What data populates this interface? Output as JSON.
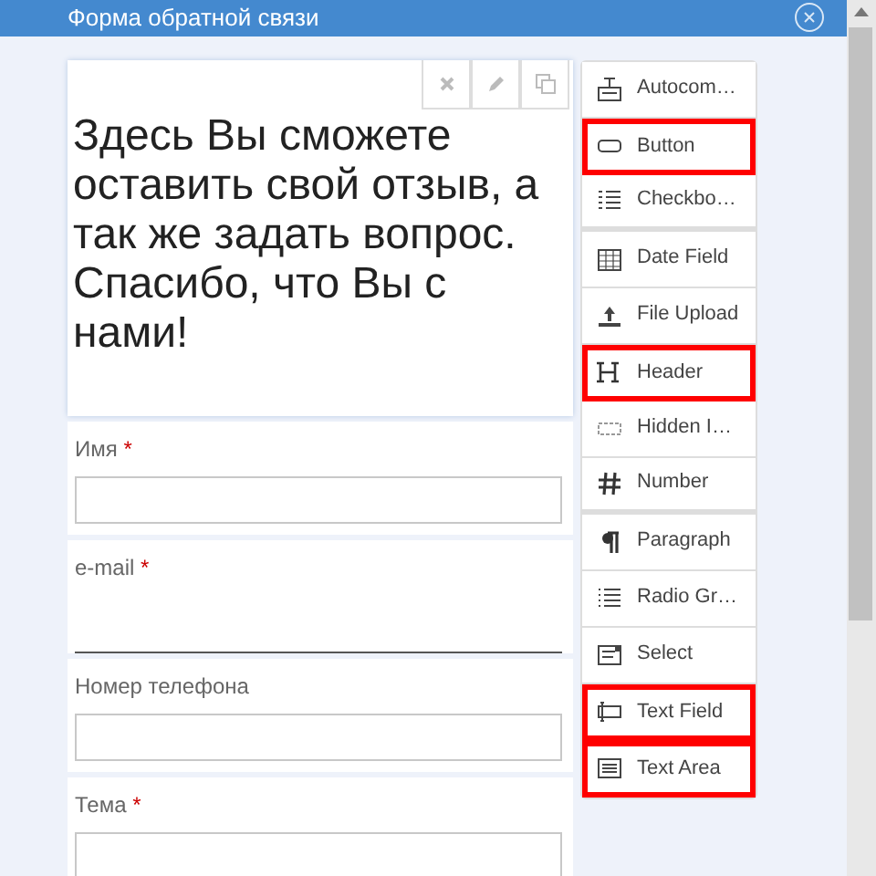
{
  "dialog": {
    "title": "Форма обратной связи"
  },
  "header_block": {
    "text": "Здесь Вы сможете оставить свой отзыв, а так же задать вопрос. Спасибо, что Вы с нами!"
  },
  "fields": [
    {
      "label": "Имя",
      "required_mark": "*",
      "kind": "box"
    },
    {
      "label": "e-mail",
      "required_mark": "*",
      "kind": "underline"
    },
    {
      "label": "Номер телефона",
      "kind": "box"
    },
    {
      "label": "Тема",
      "required_mark": "*",
      "kind": "box"
    }
  ],
  "palette": [
    {
      "label": "Autocom…",
      "highlighted": false,
      "group_end": false
    },
    {
      "label": "Button",
      "highlighted": true,
      "group_end": false
    },
    {
      "label": "Checkbo…",
      "highlighted": false,
      "group_end": true
    },
    {
      "label": "Date Field",
      "highlighted": false,
      "group_end": false
    },
    {
      "label": "File Upload",
      "highlighted": false,
      "group_end": false
    },
    {
      "label": "Header",
      "highlighted": true,
      "group_end": false
    },
    {
      "label": "Hidden I…",
      "highlighted": false,
      "group_end": false
    },
    {
      "label": "Number",
      "highlighted": false,
      "group_end": true
    },
    {
      "label": "Paragraph",
      "highlighted": false,
      "group_end": false
    },
    {
      "label": "Radio Gr…",
      "highlighted": false,
      "group_end": false
    },
    {
      "label": "Select",
      "highlighted": false,
      "group_end": false
    },
    {
      "label": "Text Field",
      "highlighted": true,
      "group_end": false
    },
    {
      "label": "Text Area",
      "highlighted": true,
      "group_end": false
    }
  ]
}
